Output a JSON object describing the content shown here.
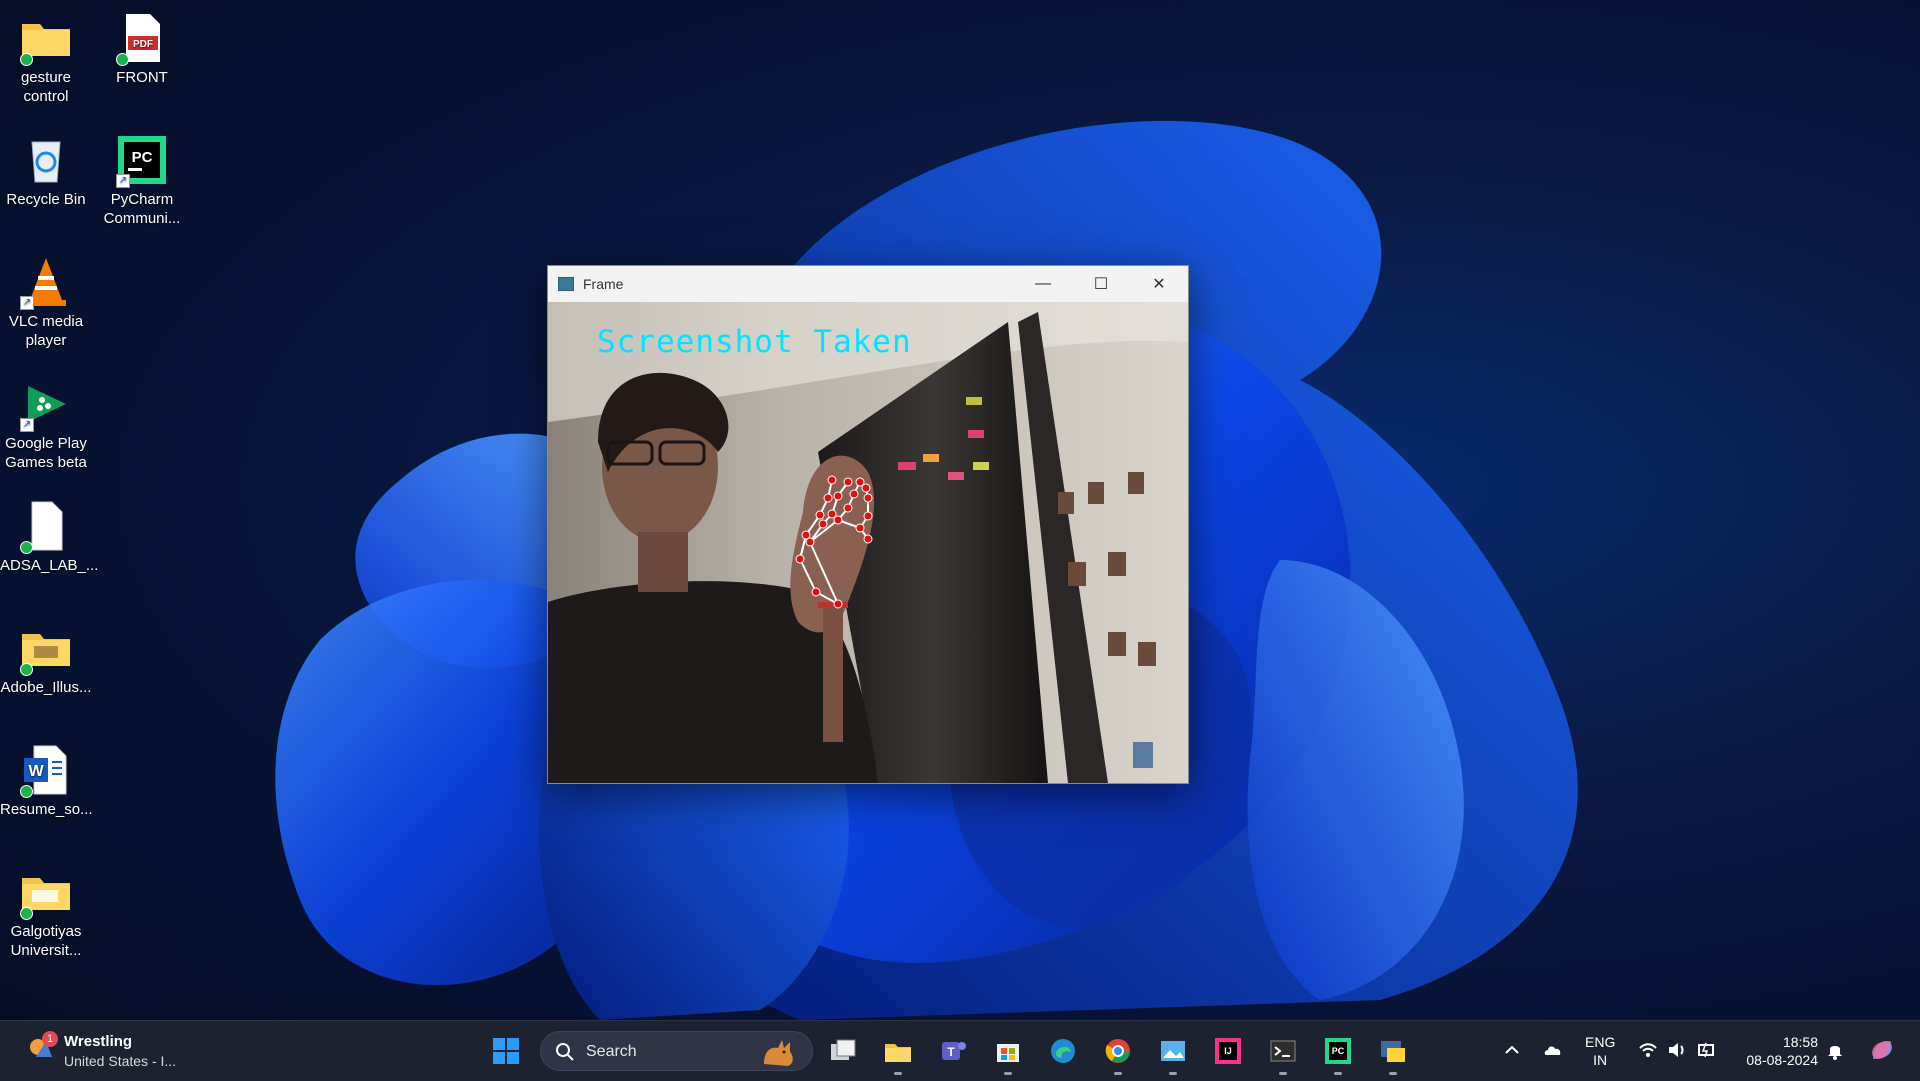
{
  "desktop": {
    "icons": [
      {
        "label": "gesture\ncontrol",
        "icon": "folder-icon"
      },
      {
        "label": "FRONT",
        "icon": "pdf-file-icon"
      },
      {
        "label": "Recycle Bin",
        "icon": "recycle-bin-icon"
      },
      {
        "label": "PyCharm\nCommuni...",
        "icon": "pycharm-icon"
      },
      {
        "label": "VLC media\nplayer",
        "icon": "vlc-icon"
      },
      {
        "label": "Google Play\nGames beta",
        "icon": "google-play-games-icon"
      },
      {
        "label": "ADSA_LAB_...",
        "icon": "blank-file-icon"
      },
      {
        "label": "Adobe_Illus...",
        "icon": "folder-icon"
      },
      {
        "label": "Resume_so...",
        "icon": "word-doc-icon"
      },
      {
        "label": "Galgotiyas\nUniversit...",
        "icon": "folder-icon"
      }
    ]
  },
  "window": {
    "title": "Frame",
    "overlay_text": "Screenshot Taken",
    "controls": {
      "minimize": "—",
      "maximize": "☐",
      "close": "✕"
    }
  },
  "taskbar": {
    "weather": {
      "badge": "1",
      "title": "Wrestling",
      "subtitle": "United States - I..."
    },
    "search": {
      "placeholder": "Search"
    },
    "pinned": [
      "windows-start-icon",
      "search-icon",
      "task-view-icon",
      "file-explorer-icon",
      "teams-icon",
      "microsoft-store-icon",
      "edge-icon",
      "chrome-icon",
      "photos-icon",
      "intellij-icon",
      "terminal-icon",
      "pycharm-icon",
      "python-icon"
    ],
    "tray": {
      "lang_line1": "ENG",
      "lang_line2": "IN",
      "time": "18:58",
      "date": "08-08-2024"
    }
  },
  "colors": {
    "overlay_text": "#00e5ff",
    "accent": "#0a5cff",
    "taskbar": "#1d2230"
  }
}
